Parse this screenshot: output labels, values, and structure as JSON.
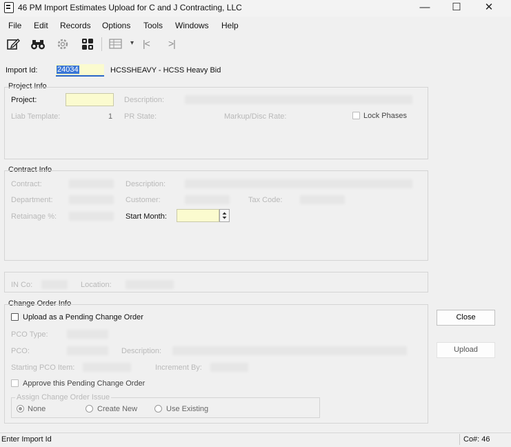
{
  "window": {
    "title": "46 PM Import Estimates Upload for C and J Contracting, LLC",
    "minimize": "—",
    "maximize": "☐",
    "close": "✕"
  },
  "menu": [
    "File",
    "Edit",
    "Records",
    "Options",
    "Tools",
    "Windows",
    "Help"
  ],
  "toolbar": {
    "icons": [
      "edit-icon",
      "binoculars-icon",
      "gear-icon",
      "grid-icon",
      "table-icon",
      "first-record-icon",
      "last-record-icon"
    ],
    "dropdown_glyph": "▾",
    "first_glyph": "|<",
    "last_glyph": ">|"
  },
  "import": {
    "label": "Import Id:",
    "value": "24034",
    "description": "HCSSHEAVY - HCSS Heavy Bid"
  },
  "project_info": {
    "title": "Project Info",
    "project_label": "Project:",
    "description_label": "Description:",
    "liab_template_label": "Liab Template:",
    "liab_template_value": "1",
    "pr_state_label": "PR State:",
    "markup_label": "Markup/Disc Rate:",
    "lock_phases_label": "Lock Phases"
  },
  "contract_info": {
    "title": "Contract Info",
    "contract_label": "Contract:",
    "description_label": "Description:",
    "department_label": "Department:",
    "customer_label": "Customer:",
    "tax_code_label": "Tax Code:",
    "retainage_label": "Retainage %:",
    "start_month_label": "Start Month:"
  },
  "inventory": {
    "in_co_label": "IN Co:",
    "location_label": "Location:"
  },
  "change_order": {
    "title": "Change Order Info",
    "upload_pending_label": "Upload as a Pending Change Order",
    "pco_type_label": "PCO Type:",
    "pco_label": "PCO:",
    "description_label": "Description:",
    "starting_item_label": "Starting PCO Item:",
    "increment_label": "Increment By:",
    "approve_label": "Approve this Pending Change Order",
    "assign_title": "Assign Change Order Issue",
    "options": [
      "None",
      "Create New",
      "Use Existing"
    ],
    "selected": "None"
  },
  "buttons": {
    "close": "Close",
    "upload": "Upload"
  },
  "status": {
    "message": "Enter Import Id",
    "company": "Co#: 46"
  }
}
